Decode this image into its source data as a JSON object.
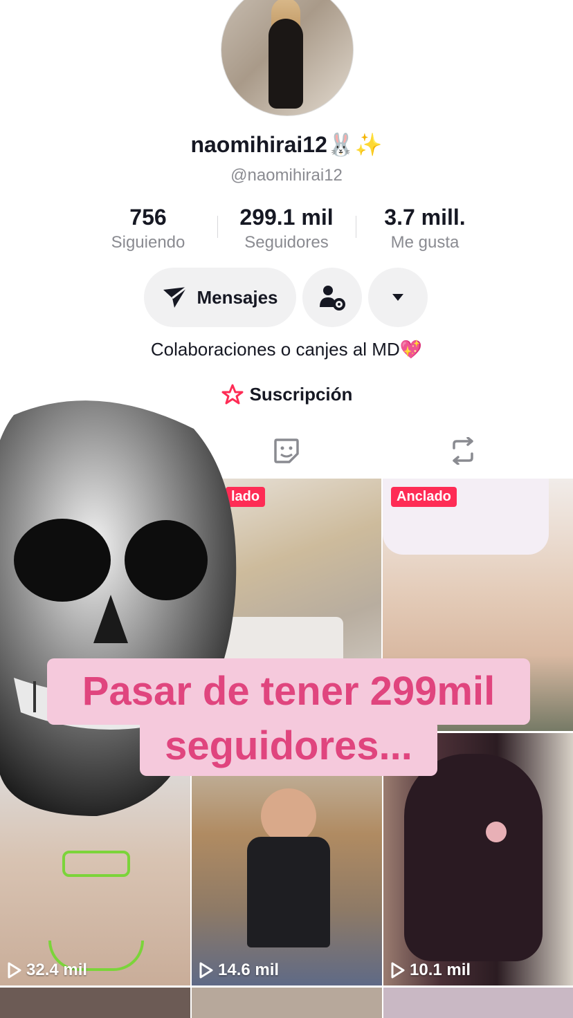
{
  "profile": {
    "display_name": "naomihirai12🐰✨",
    "handle": "@naomihirai12",
    "stats": [
      {
        "value": "756",
        "label": "Siguiendo"
      },
      {
        "value": "299.1 mil",
        "label": "Seguidores"
      },
      {
        "value": "3.7 mill.",
        "label": "Me gusta"
      }
    ],
    "message_button": "Mensajes",
    "bio": "Colaboraciones o canjes al MD💖",
    "subscription_label": "Suscripción"
  },
  "tabs": [
    {
      "icon": "sticker-icon"
    },
    {
      "icon": "repost-icon"
    }
  ],
  "grid": {
    "pinned_label_partial": "lado",
    "pinned_label": "Anclado",
    "views": [
      "32.4 mil",
      "14.6 mil",
      "10.1 mil"
    ]
  },
  "overlay": {
    "caption_line1": "Pasar de tener 299mil",
    "caption_line2": "seguidores..."
  },
  "colors": {
    "accent": "#fe2c55",
    "caption_bg": "#f5c9dc",
    "caption_text": "#e0457e"
  }
}
